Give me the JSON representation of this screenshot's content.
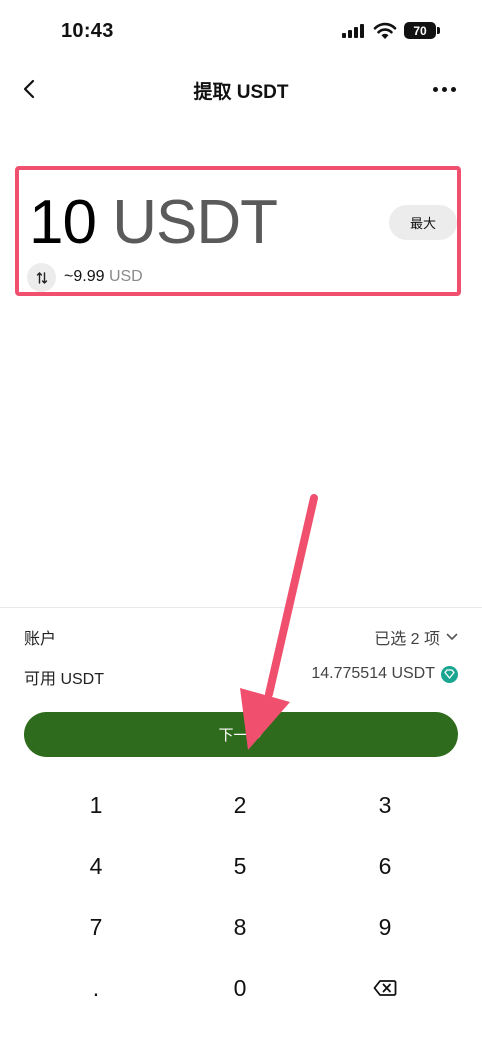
{
  "status_bar": {
    "time": "10:43",
    "battery": "70"
  },
  "nav": {
    "title": "提取 USDT"
  },
  "amount": {
    "value": "10",
    "unit": "USDT",
    "max_label": "最大",
    "converted_value": "~9.99",
    "converted_unit": "USD"
  },
  "account_row": {
    "label": "账户",
    "value": "已选 2 项"
  },
  "available_row": {
    "label": "可用 USDT",
    "value": "14.775514 USDT"
  },
  "next_button": {
    "label": "下一步"
  },
  "keypad": {
    "keys": [
      "1",
      "2",
      "3",
      "4",
      "5",
      "6",
      "7",
      "8",
      "9",
      ".",
      "0"
    ]
  },
  "colors": {
    "primary_button": "#2e6b1c",
    "annotation": "#f0506e",
    "gem_badge": "#1aa591"
  }
}
